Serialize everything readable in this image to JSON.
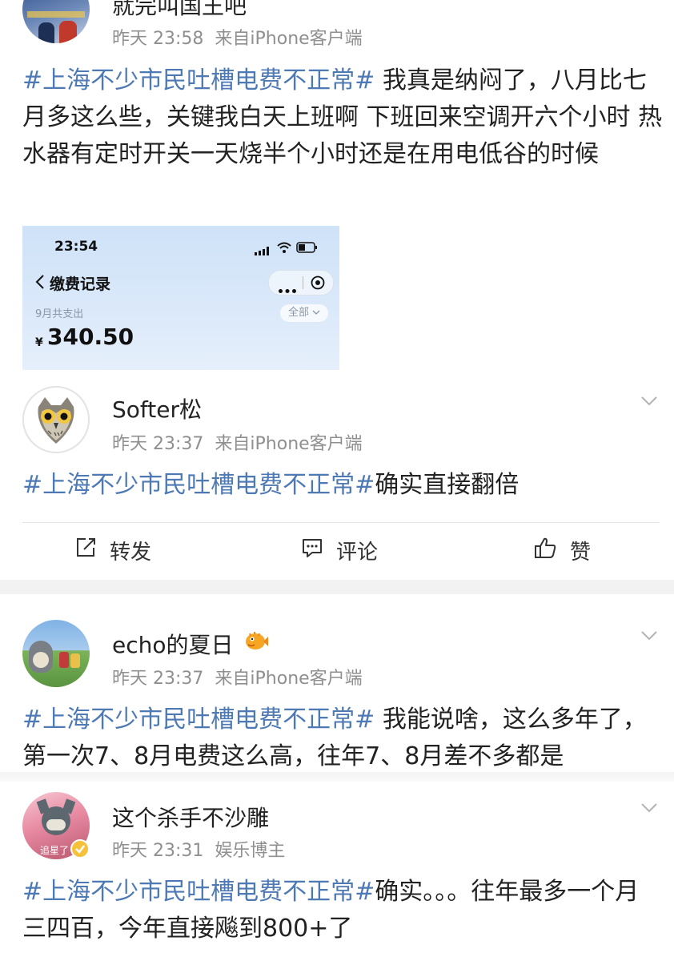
{
  "post1": {
    "name": "就完叫国王吧",
    "time": "昨天 23:58",
    "source": "来自iPhone客户端",
    "hashtag": "#上海不少市民吐槽电费不正常#",
    "text": " 我真是纳闷了，八月比七月多这么些，关键我白天上班啊 下班回来空调开六个小时  热水器有定时开关一天烧半个小时还是在用电低谷的时候",
    "image": {
      "clock": "23:54",
      "nav_title": "缴费记录",
      "label": "9月共支出",
      "filter": "全部",
      "currency": "¥",
      "amount": "340.50"
    }
  },
  "post2": {
    "name": "Softer松",
    "time": "昨天 23:37",
    "source": "来自iPhone客户端",
    "hashtag": "#上海不少市民吐槽电费不正常#",
    "text": "确实直接翻倍",
    "actions": {
      "repost": "转发",
      "comment": "评论",
      "like": "赞"
    }
  },
  "post3": {
    "name": "echo的夏日",
    "time": "昨天 23:37",
    "source": "来自iPhone客户端",
    "hashtag": "#上海不少市民吐槽电费不正常#",
    "text": " 我能说啥，这么多年了，第一次7、8月电费这么高，往年7、8月差不多都是"
  },
  "post4": {
    "name": "这个杀手不沙雕",
    "time": "昨天 23:31",
    "source": "娱乐博主",
    "hashtag": "#上海不少市民吐槽电费不正常#",
    "text": "确实。。。往年最多一个月三四百，今年直接飚到800+了",
    "avatar_caption": "追星了"
  },
  "colors": {
    "hashtag": "#4d79b5",
    "meta": "#8f8f8f",
    "gap": "#f2f2f2"
  }
}
